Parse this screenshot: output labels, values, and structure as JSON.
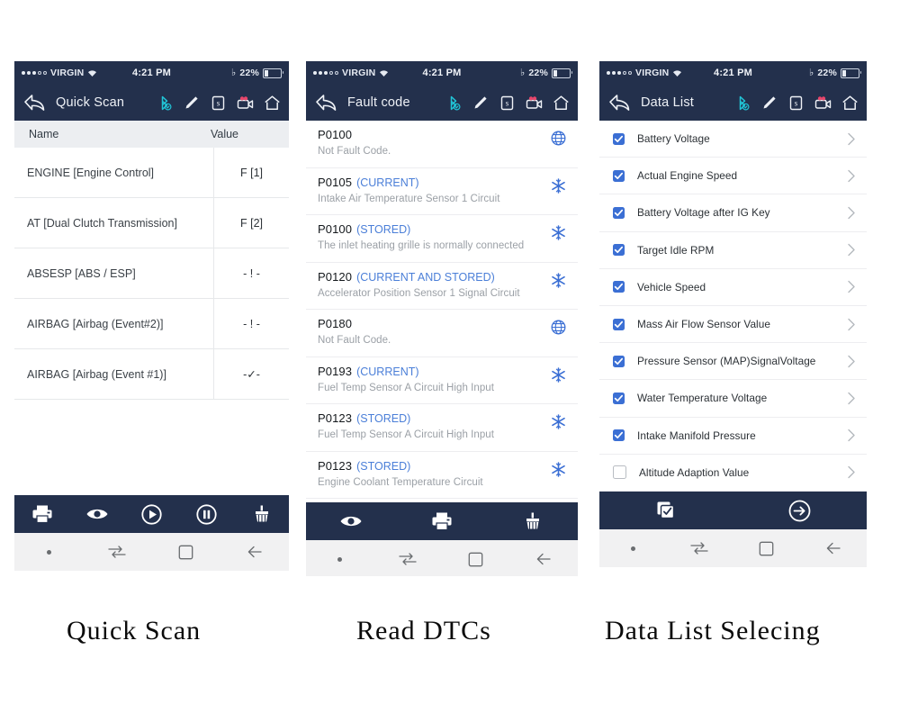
{
  "status_bar": {
    "carrier": "VIRGIN",
    "time": "4:21 PM",
    "battery_pct": "22%",
    "signal_dots_filled": 3,
    "signal_dots_empty": 2
  },
  "panels": [
    {
      "id": "quick-scan",
      "nav_title": "Quick Scan",
      "caption": "Quick Scan",
      "table": {
        "headers": [
          "Name",
          "Value"
        ],
        "rows": [
          {
            "name": "ENGINE [Engine Control]",
            "value": "F [1]"
          },
          {
            "name": "AT [Dual Clutch Transmission]",
            "value": "F [2]"
          },
          {
            "name": "ABSESP [ABS / ESP]",
            "value": "- ! -"
          },
          {
            "name": "AIRBAG [Airbag (Event#2)]",
            "value": "- ! -"
          },
          {
            "name": "AIRBAG [Airbag (Event #1)]",
            "value": "-✓-"
          }
        ]
      },
      "toolbar": [
        {
          "icon": "printer-icon",
          "label": "Print"
        },
        {
          "icon": "eye-icon",
          "label": "View"
        },
        {
          "icon": "play-circle-icon",
          "label": "Play"
        },
        {
          "icon": "pause-circle-icon",
          "label": "Pause"
        },
        {
          "icon": "broom-icon",
          "label": "Clear"
        }
      ]
    },
    {
      "id": "fault-code",
      "nav_title": "Fault code",
      "caption": "Read DTCs",
      "dtc_rows": [
        {
          "code": "P0100",
          "state": "",
          "desc": "Not Fault Code.",
          "icon": "globe-icon"
        },
        {
          "code": "P0105",
          "state": "(CURRENT)",
          "desc": "Intake Air Temperature Sensor 1 Circuit",
          "icon": "snowflake-icon"
        },
        {
          "code": "P0100",
          "state": "(STORED)",
          "desc": "The inlet heating grille is normally connected",
          "icon": "snowflake-icon"
        },
        {
          "code": "P0120",
          "state": "(CURRENT AND STORED)",
          "desc": "Accelerator Position Sensor 1 Signal Circuit",
          "icon": "snowflake-icon"
        },
        {
          "code": "P0180",
          "state": "",
          "desc": "Not Fault Code.",
          "icon": "globe-icon"
        },
        {
          "code": "P0193",
          "state": "(CURRENT)",
          "desc": "Fuel Temp Sensor A Circuit High Input",
          "icon": "snowflake-icon"
        },
        {
          "code": "P0123",
          "state": "(STORED)",
          "desc": "Fuel Temp Sensor A Circuit High Input",
          "icon": "snowflake-icon"
        },
        {
          "code": "P0123",
          "state": "(STORED)",
          "desc": "Engine Coolant Temperature Circuit",
          "icon": "snowflake-icon"
        }
      ],
      "toolbar": [
        {
          "icon": "eye-icon",
          "label": "View"
        },
        {
          "icon": "printer-icon",
          "label": "Print"
        },
        {
          "icon": "broom-icon",
          "label": "Clear"
        }
      ]
    },
    {
      "id": "data-list",
      "nav_title": "Data List",
      "caption": "Data List Selecing",
      "data_rows": [
        {
          "label": "Battery Voltage",
          "checked": true
        },
        {
          "label": "Actual Engine Speed",
          "checked": true
        },
        {
          "label": "Battery Voltage after IG Key",
          "checked": true
        },
        {
          "label": "Target Idle RPM",
          "checked": true
        },
        {
          "label": "Vehicle Speed",
          "checked": true
        },
        {
          "label": "Mass Air Flow Sensor Value",
          "checked": true
        },
        {
          "label": "Pressure Sensor (MAP)SignalVoltage",
          "checked": true
        },
        {
          "label": "Water Temperature Voltage",
          "checked": true
        },
        {
          "label": "Intake Manifold Pressure",
          "checked": true
        },
        {
          "label": "Altitude Adaption Value",
          "checked": false
        }
      ],
      "toolbar": [
        {
          "icon": "select-all-icon",
          "label": "Select All"
        },
        {
          "icon": "arrow-right-circle-icon",
          "label": "Next"
        }
      ]
    }
  ],
  "nav_icons": [
    {
      "icon": "bluetooth-connected-icon",
      "label": "Bluetooth"
    },
    {
      "icon": "pencil-icon",
      "label": "Edit"
    },
    {
      "icon": "screenshot-s-icon",
      "label": "Screenshot"
    },
    {
      "icon": "video-camera-icon",
      "label": "Record"
    },
    {
      "icon": "home-icon",
      "label": "Home"
    }
  ],
  "softkeys": [
    {
      "icon": "dot-icon",
      "label": ""
    },
    {
      "icon": "switch-icon",
      "label": "Recents"
    },
    {
      "icon": "square-icon",
      "label": "Home"
    },
    {
      "icon": "back-arrow-icon",
      "label": "Back"
    }
  ],
  "colors": {
    "nav_dark": "#23304c",
    "accent_blue": "#3b6fd4",
    "state_blue": "#4b7fd8",
    "bluetooth_cyan": "#21c4d6",
    "desc_gray": "#9ba0a6",
    "table_head_bg": "#eceef1"
  }
}
